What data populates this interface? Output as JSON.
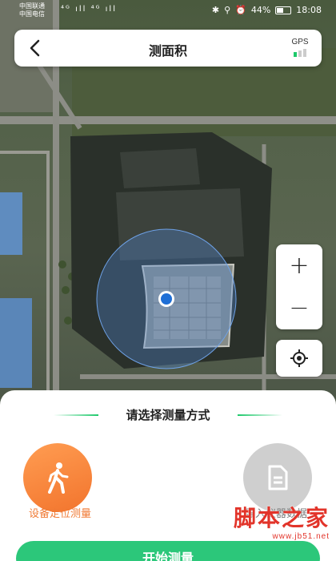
{
  "status_bar": {
    "carrier_1": "中国联通",
    "carrier_2": "中国电信",
    "signal_icons": "⁴ᴳ ıll ⁴ᴳ ıll",
    "battery": "44%",
    "time": "18:08"
  },
  "header": {
    "title": "测面积",
    "gps_label": "GPS",
    "gps_signal_level": 0.33
  },
  "map_controls": {
    "zoom_in": "+",
    "zoom_out": "−"
  },
  "sheet": {
    "title": "请选择测量方式",
    "options": [
      {
        "label": "设备定位测量",
        "icon": "walking-person-icon",
        "selected": true
      },
      {
        "label": "导入仪器数据",
        "icon": "document-icon",
        "selected": false
      }
    ],
    "start_button": "开始测量"
  },
  "colors": {
    "accent_green": "#2cc77a",
    "selected_orange": "#f2742d",
    "unselected_gray": "#cfcfcf"
  },
  "watermark": {
    "text": "脚本之家",
    "url": "www.jb51.net"
  }
}
